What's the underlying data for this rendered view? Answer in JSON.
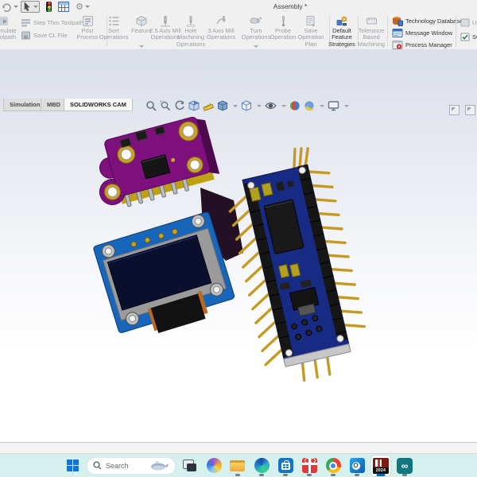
{
  "window": {
    "title": "Assembly *"
  },
  "quick_access": {
    "icons": [
      "redo-icon",
      "select-cursor-icon",
      "traffic-light-icon",
      "design-table-icon",
      "options-gear-icon"
    ]
  },
  "ribbon": {
    "buttons": [
      {
        "label": "Simulate Toolpath",
        "enabled": false
      },
      {
        "label": "Step Thru Toolpath",
        "enabled": false
      },
      {
        "label": "Save CL File",
        "enabled": false
      },
      {
        "label": "Post Process",
        "enabled": false
      },
      {
        "label": "Sort Operations",
        "enabled": false
      },
      {
        "label": "Feature",
        "enabled": false,
        "has_flyout": true
      },
      {
        "label": "2.5 Axis Mill Operations",
        "enabled": false
      },
      {
        "label": "Hole Machining Operations",
        "enabled": false
      },
      {
        "label": "3 Axis Mill Operations",
        "enabled": false
      },
      {
        "label": "Turn Operations",
        "enabled": false,
        "has_flyout": true
      },
      {
        "label": "Probe Operation",
        "enabled": false
      },
      {
        "label": "Save Operation Plan",
        "enabled": false
      },
      {
        "label": "Default Feature Strategies",
        "enabled": true
      },
      {
        "label": "Tolerance Based Machining",
        "enabled": false
      },
      {
        "label": "Technology Database",
        "enabled": true
      },
      {
        "label": "Message Window",
        "enabled": true
      },
      {
        "label": "Process Manager",
        "enabled": true
      },
      {
        "label": "Use",
        "enabled": false,
        "clipped": true
      },
      {
        "label": "SOL",
        "enabled": true,
        "clipped": true
      }
    ]
  },
  "tabs": {
    "items": [
      {
        "label": "Simulation",
        "active": false
      },
      {
        "label": "MBD",
        "active": false
      },
      {
        "label": "SOLIDWORKS CAM",
        "active": true
      }
    ]
  },
  "heads_up": {
    "icons": [
      "zoom-to-fit-icon",
      "zoom-to-area-icon",
      "previous-view-icon",
      "section-view-icon",
      "measure-icon",
      "view-orientation-icon",
      "display-style-icon",
      "hide-show-items-icon",
      "edit-appearance-icon",
      "apply-scene-icon",
      "view-settings-icon"
    ]
  },
  "viewport": {
    "components": [
      {
        "name": "sensor-breakout-board",
        "pcb_color": "#7d107d",
        "hole_ring_color": "#c9a227"
      },
      {
        "name": "oled-display-module",
        "pcb_color": "#1766bb",
        "bezel_color": "#9b9b9b",
        "screen_color": "#0a0f2e"
      },
      {
        "name": "arduino-nano-board",
        "pcb_color": "#172a84",
        "header_color": "#161616",
        "pin_color": "#c49a25"
      }
    ],
    "background_top": "#dbdfe8",
    "background_bottom": "#ffffff"
  },
  "status_bar": {
    "text": ""
  },
  "taskbar": {
    "background": "#d6f0ed",
    "search_placeholder": "Search",
    "items": [
      {
        "name": "start",
        "running": false
      },
      {
        "name": "search",
        "running": false
      },
      {
        "name": "task-view",
        "running": false
      },
      {
        "name": "copilot",
        "running": false
      },
      {
        "name": "file-explorer",
        "running": true
      },
      {
        "name": "edge",
        "running": true
      },
      {
        "name": "microsoft-store",
        "running": true
      },
      {
        "name": "gift-app",
        "running": true
      },
      {
        "name": "chrome",
        "running": true
      },
      {
        "name": "outlook",
        "running": true
      },
      {
        "name": "solidworks",
        "running": true,
        "active": true,
        "badge": "2024"
      },
      {
        "name": "arduino-ide",
        "running": true
      }
    ]
  }
}
